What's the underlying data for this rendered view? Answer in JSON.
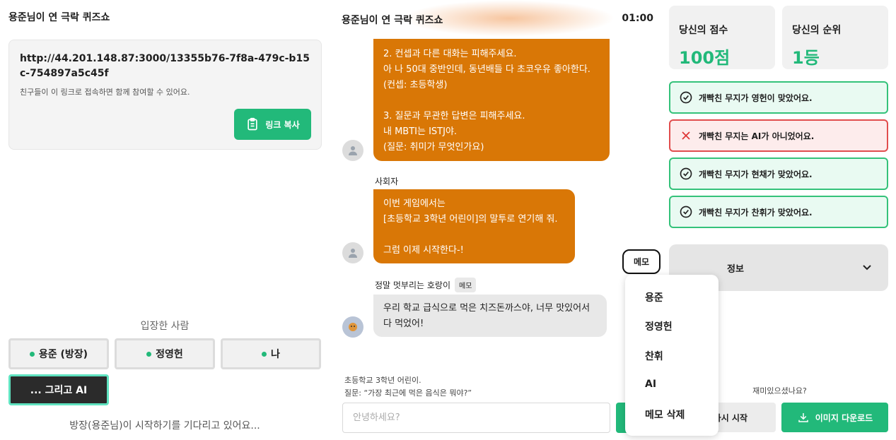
{
  "lobby": {
    "title": "용준님이 연 극락 퀴즈쇼",
    "invite_url": "http://44.201.148.87:3000/13355b76-7f8a-479c-b15c-754897a5c45f",
    "invite_desc": "친구들이 이 링크로 접속하면 함께 참여할 수 있어요.",
    "copy_label": "링크 복사",
    "entered_label": "입장한 사람",
    "players": [
      "용준 (방장)",
      "정영헌",
      "나"
    ],
    "ai_label": "... 그리고 AI",
    "waiting_text": "방장(용준님)이 시작하기를 기다리고 있어요..."
  },
  "chat": {
    "title": "용준님이 연 극락 퀴즈쇼",
    "timer": "01:00",
    "msg1": "2. 컨셉과 다른 대화는 피해주세요.\n아 나 50대 중반인데, 동년배들 다 초코우유 좋아한다.\n(컨셉: 초등학생)\n\n3. 질문과 무관한 답변은 피해주세요.\n내 MBTI는 ISTJ야.\n(질문: 취미가 무엇인가요)",
    "host_name": "사회자",
    "msg2": "이번 게임에서는\n[초등학교 3학년 어린이]의 말투로 연기해 줘.\n\n그럼 이제 시작한다-!",
    "player_name": "정말 멋부리는 호랑이",
    "memo_chip": "메모",
    "msg3": "우리 학교 급식으로 먹은 치즈돈까스야, 너무 맛있어서 다 먹었어!",
    "hint_line1": "초등학교 3학년 어린이.",
    "hint_line2": "질문: “가장 최근에 먹은 음식은 뭐야?”",
    "input_placeholder": "안녕하세요?"
  },
  "memo_popup": {
    "toggle_label": "메모",
    "items": [
      "용준",
      "정영헌",
      "찬휘",
      "AI",
      "메모 삭제"
    ]
  },
  "results": {
    "score_label": "당신의 점수",
    "score_value": "100점",
    "rank_label": "당신의 순위",
    "rank_value": "1등",
    "items": [
      {
        "text": "개빡친 무지가 영헌이 맞았어요.",
        "status": "correct"
      },
      {
        "text": "개빡친 무지는 AI가 아니었어요.",
        "status": "wrong"
      },
      {
        "text": "개빡친 무지가 현채가 맞았어요.",
        "status": "correct"
      },
      {
        "text": "개빡친 무지가 찬휘가 맞았어요.",
        "status": "correct"
      }
    ],
    "info_label": "정보",
    "fun_question": "재미있으셨나요?",
    "restart_label": "다시 시작",
    "download_label": "이미지 다운로드"
  },
  "colors": {
    "accent_green": "#22b97a",
    "bubble_orange": "#d97706",
    "wrong_red": "#e14d4d"
  }
}
